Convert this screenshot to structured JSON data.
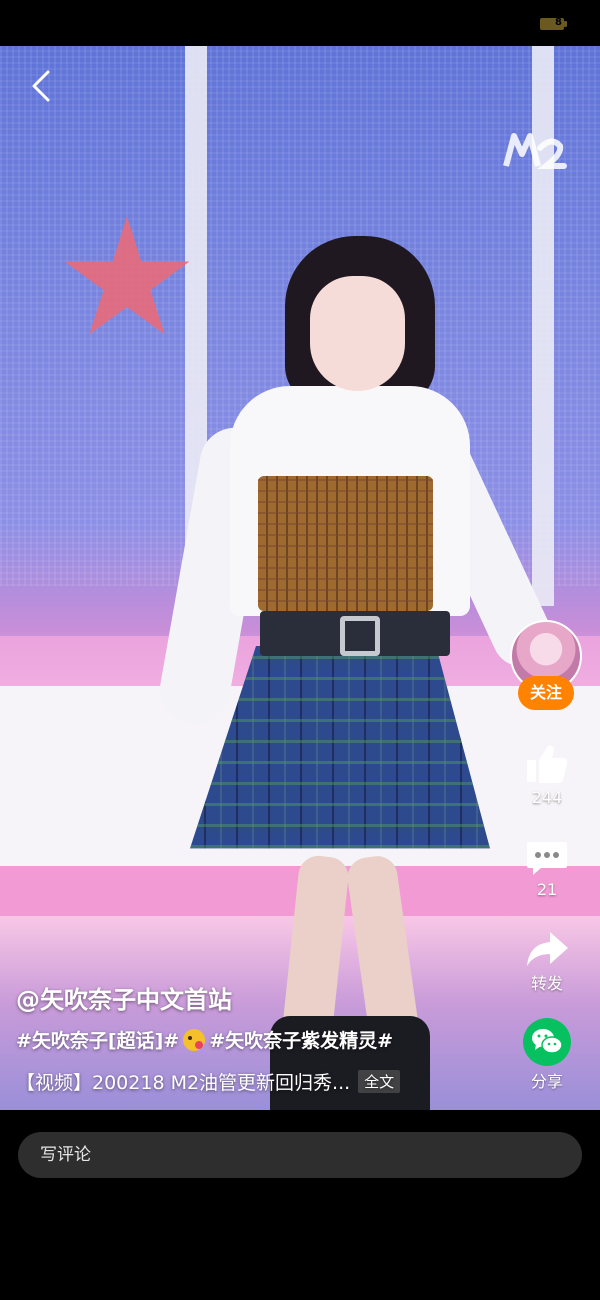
{
  "status_bar": {
    "battery_text": "8"
  },
  "video": {
    "channel_logo": "M2"
  },
  "sidebar": {
    "follow_label": "关注",
    "like_count": "244",
    "comment_count": "21",
    "repost_label": "转发",
    "share_label": "分享"
  },
  "post": {
    "author": "@矢吹奈子中文首站",
    "hashtag_1": "#矢吹奈子[超话]#",
    "hashtag_2": "#矢吹奈子紫发精灵#",
    "caption": "【视频】200218 M2油管更新回归秀...",
    "fulltext_label": "全文"
  },
  "comment_bar": {
    "placeholder": "写评论"
  },
  "icons": {
    "back": "chevron-left-icon",
    "like": "thumbs-up-icon",
    "comment": "speech-bubble-icon",
    "repost": "share-arrow-icon",
    "share": "wechat-icon",
    "emoji": "tongue-emoji-icon"
  },
  "colors": {
    "follow_button": "#ff8200",
    "wechat_green": "#07c160",
    "comment_bar_bg": "#2e2e2e"
  }
}
